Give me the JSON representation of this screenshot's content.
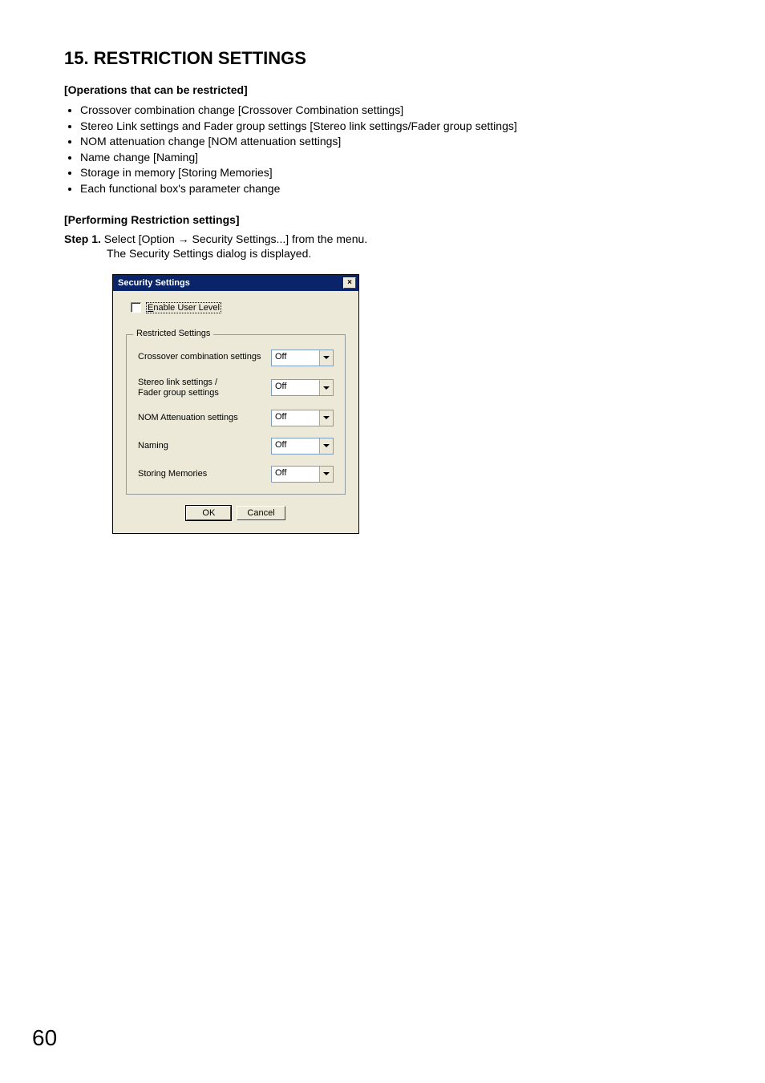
{
  "heading": "15. RESTRICTION SETTINGS",
  "section1_title": "[Operations that can be restricted]",
  "bullets": [
    "Crossover combination change [Crossover Combination settings]",
    "Stereo Link settings and Fader group settings [Stereo link settings/Fader group settings]",
    "NOM attenuation change [NOM attenuation settings]",
    "Name change [Naming]",
    "Storage in memory [Storing Memories]",
    "Each functional box's parameter change"
  ],
  "section2_title": "[Performing Restriction settings]",
  "step": {
    "label": "Step 1.",
    "text": "Select [Option → Security Settings...] from the menu.",
    "desc": "The Security Settings dialog is displayed."
  },
  "dialog": {
    "title": "Security Settings",
    "checkbox_label_prefix": "E",
    "checkbox_label_rest": "nable User Level",
    "group_title": "Restricted Settings",
    "rows": [
      {
        "label": "Crossover combination settings",
        "value": "Off"
      },
      {
        "label": "Stereo link settings /\nFader group settings",
        "value": "Off"
      },
      {
        "label": "NOM Attenuation settings",
        "value": "Off"
      },
      {
        "label": "Naming",
        "value": "Off"
      },
      {
        "label": "Storing Memories",
        "value": "Off"
      }
    ],
    "ok": "OK",
    "cancel": "Cancel"
  },
  "page_number": "60"
}
